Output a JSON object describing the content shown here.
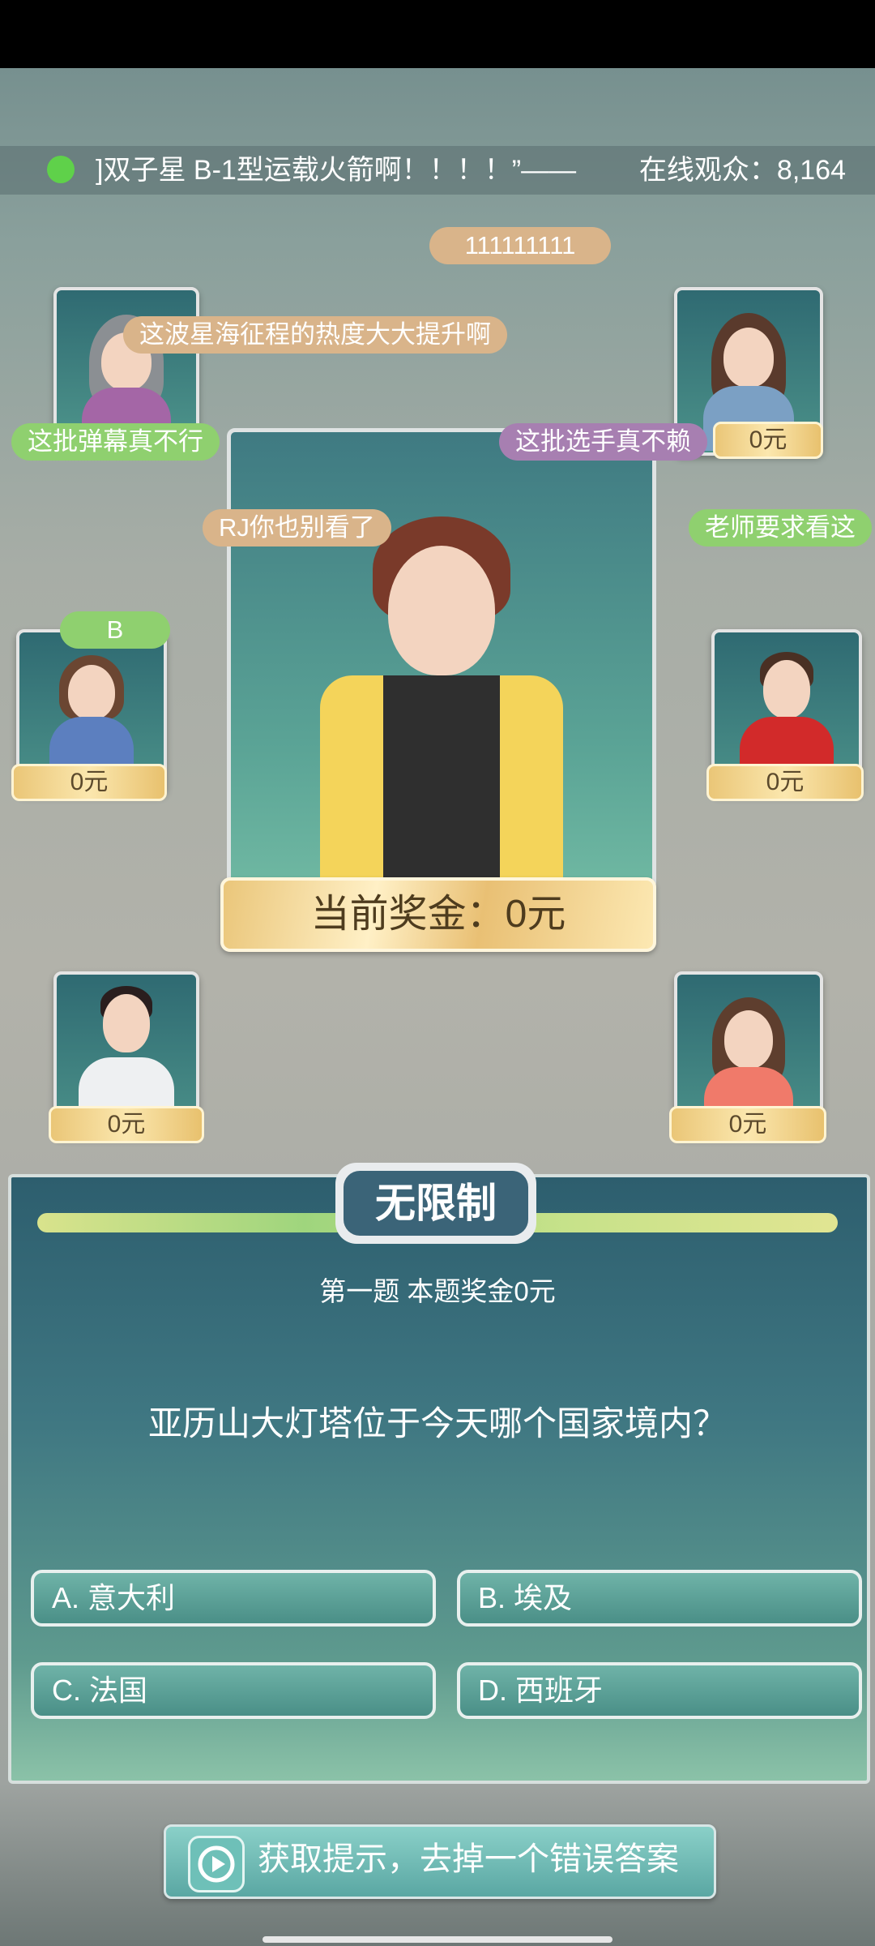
{
  "header": {
    "marquee_text": "]双子星 B-1型运载火箭啊！！！！”——",
    "viewers_text": "在线观众：8,164"
  },
  "danmaku": [
    "111111111",
    "这波星海征程的热度大大提升啊",
    "这批弹幕真不行",
    "这批选手真不赖",
    "RJ你也别看了",
    "老师要求看这",
    "B"
  ],
  "players": [
    {
      "prize": ""
    },
    {
      "prize": "0元"
    },
    {
      "prize": "0元"
    },
    {
      "prize": "0元"
    },
    {
      "prize": "0元"
    },
    {
      "prize": "0元"
    }
  ],
  "main_player": {
    "prize_label": "当前奖金：0元"
  },
  "quiz": {
    "mode_label": "无限制",
    "subtitle": "第一题 本题奖金0元",
    "question": "亚历山大灯塔位于今天哪个国家境内？",
    "options": [
      "A. 意大利",
      "B. 埃及",
      "C. 法国",
      "D. 西班牙"
    ]
  },
  "hint_button": {
    "label": "获取提示，去掉一个错误答案"
  },
  "colors": {
    "accent_green": "#5fd14a",
    "panel_blue": "#3b6478",
    "gold": "#eac677"
  }
}
